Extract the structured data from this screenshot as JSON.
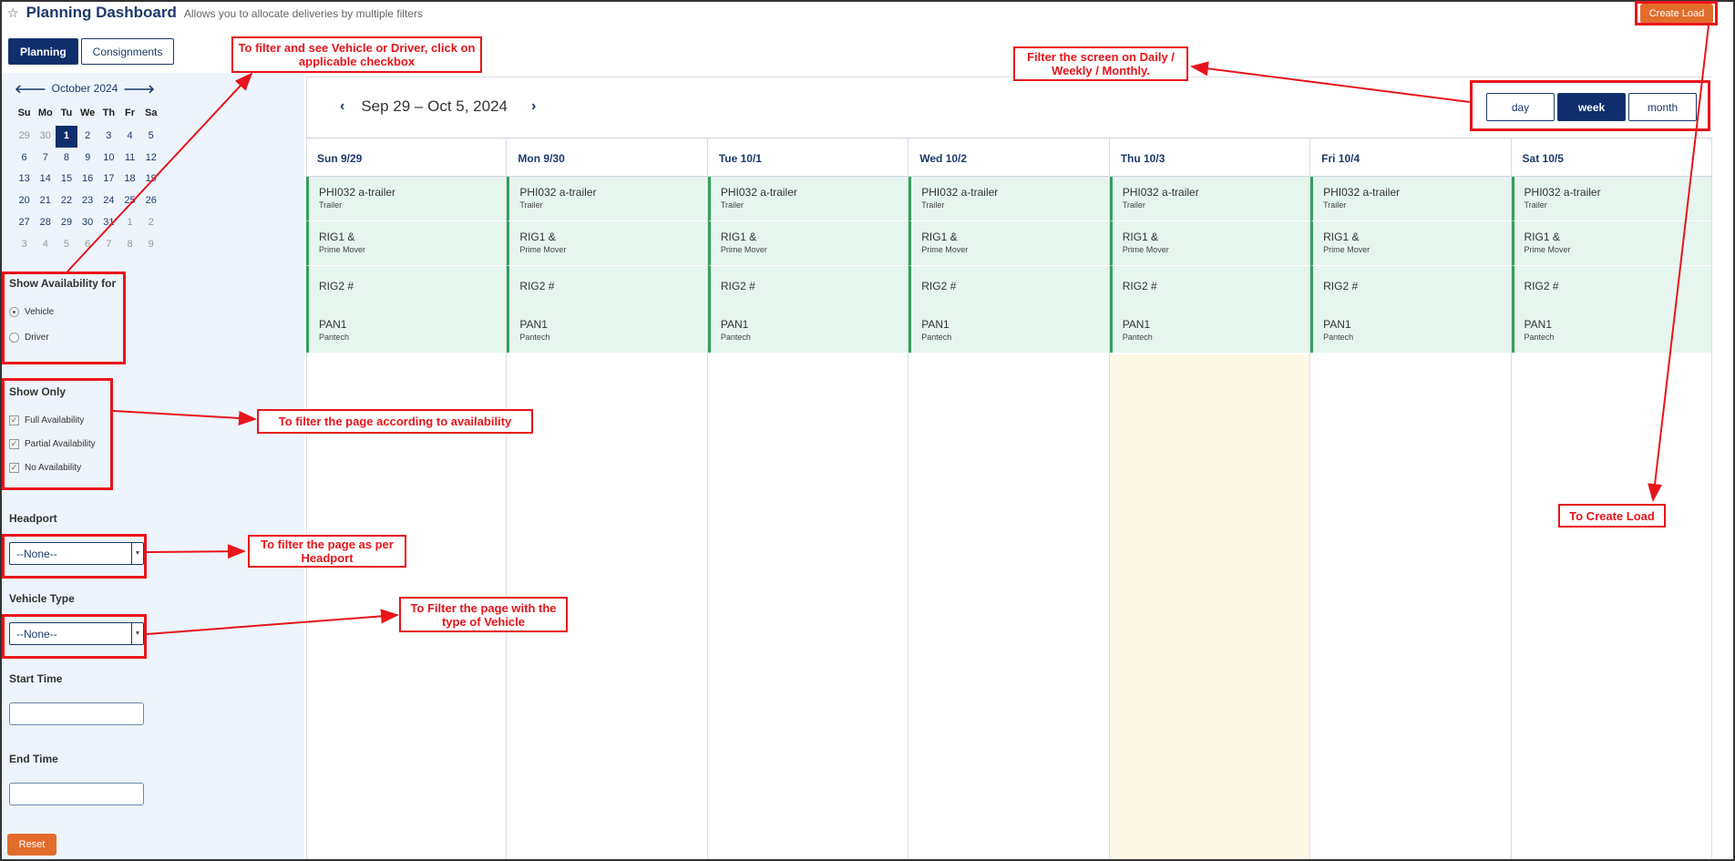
{
  "header": {
    "star_icon": "☆",
    "title": "Planning Dashboard",
    "subtitle": "Allows you to allocate deliveries by multiple filters",
    "create_load": "Create Load"
  },
  "tabs": [
    {
      "label": "Planning",
      "active": true
    },
    {
      "label": "Consignments",
      "active": false
    }
  ],
  "calendar": {
    "month_label": "October 2024",
    "prev_icon": "arrow-left-icon",
    "next_icon": "arrow-right-icon",
    "day_headers": [
      "Su",
      "Mo",
      "Tu",
      "We",
      "Th",
      "Fr",
      "Sa"
    ],
    "weeks": [
      [
        "29",
        "30",
        "1",
        "2",
        "3",
        "4",
        "5"
      ],
      [
        "6",
        "7",
        "8",
        "9",
        "10",
        "11",
        "12"
      ],
      [
        "13",
        "14",
        "15",
        "16",
        "17",
        "18",
        "19"
      ],
      [
        "20",
        "21",
        "22",
        "23",
        "24",
        "25",
        "26"
      ],
      [
        "27",
        "28",
        "29",
        "30",
        "31",
        "1",
        "2"
      ],
      [
        "3",
        "4",
        "5",
        "6",
        "7",
        "8",
        "9"
      ]
    ],
    "selected": "1"
  },
  "filters": {
    "availability_label": "Show Availability for",
    "availability_options": [
      {
        "label": "Vehicle",
        "checked": true
      },
      {
        "label": "Driver",
        "checked": false
      }
    ],
    "show_only_label": "Show Only",
    "show_only_options": [
      {
        "label": "Full Availability",
        "checked": true
      },
      {
        "label": "Partial Availability",
        "checked": true
      },
      {
        "label": "No Availability",
        "checked": true
      }
    ],
    "headport_label": "Headport",
    "headport_value": "--None--",
    "vehicle_type_label": "Vehicle Type",
    "vehicle_type_value": "--None--",
    "start_time_label": "Start Time",
    "end_time_label": "End Time",
    "reset": "Reset"
  },
  "scheduler": {
    "range": "Sep 29 – Oct 5, 2024",
    "prev": "‹",
    "next": "›",
    "views": [
      {
        "label": "day",
        "active": false
      },
      {
        "label": "week",
        "active": true
      },
      {
        "label": "month",
        "active": false
      }
    ],
    "days": [
      "Sun 9/29",
      "Mon 9/30",
      "Tue 10/1",
      "Wed 10/2",
      "Thu 10/3",
      "Fri 10/4",
      "Sat 10/5"
    ],
    "today_index": 4,
    "events": [
      {
        "name": "PHI032 a-trailer",
        "sub": "Trailer"
      },
      {
        "name": "RIG1 &",
        "sub": "Prime Mover"
      },
      {
        "name": "RIG2 #",
        "sub": ""
      },
      {
        "name": "PAN1",
        "sub": "Pantech"
      }
    ]
  },
  "annotations": {
    "vehicle_driver": "To filter and see Vehicle or Driver, click on applicable checkbox",
    "availability": "To filter the page according to availability",
    "headport": "To filter the page as per Headport",
    "vehicle_type": "To Filter the page with the type of Vehicle",
    "view_filter": "Filter the screen on Daily / Weekly / Monthly.",
    "create_load": "To Create Load"
  },
  "colors": {
    "brand": "#0e2f6b",
    "accent": "#e26c2b",
    "event_bg": "#e6f5ee",
    "event_border": "#34a05c",
    "today_bg": "#fdf7e6",
    "annotation": "#e8141b"
  }
}
